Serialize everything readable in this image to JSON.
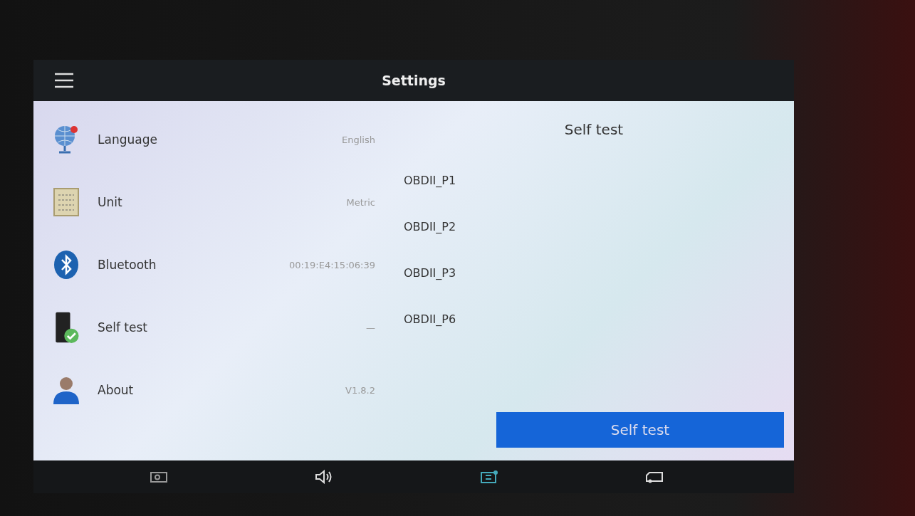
{
  "title_bar": {
    "title": "Settings"
  },
  "settings": [
    {
      "kind": "language",
      "label": "Language",
      "value": "English"
    },
    {
      "kind": "unit",
      "label": "Unit",
      "value": "Metric"
    },
    {
      "kind": "bluetooth",
      "label": "Bluetooth",
      "value": "00:19:E4:15:06:39"
    },
    {
      "kind": "selftest",
      "label": "Self test",
      "value": "—"
    },
    {
      "kind": "about",
      "label": "About",
      "value": "V1.8.2"
    }
  ],
  "self_test": {
    "title": "Self test",
    "ports": [
      "OBDII_P1",
      "OBDII_P2",
      "OBDII_P3",
      "OBDII_P6"
    ],
    "button": "Self test"
  },
  "bottom_bar": [
    {
      "kind": "screenshot"
    },
    {
      "kind": "volume"
    },
    {
      "kind": "device"
    },
    {
      "kind": "truck"
    }
  ]
}
